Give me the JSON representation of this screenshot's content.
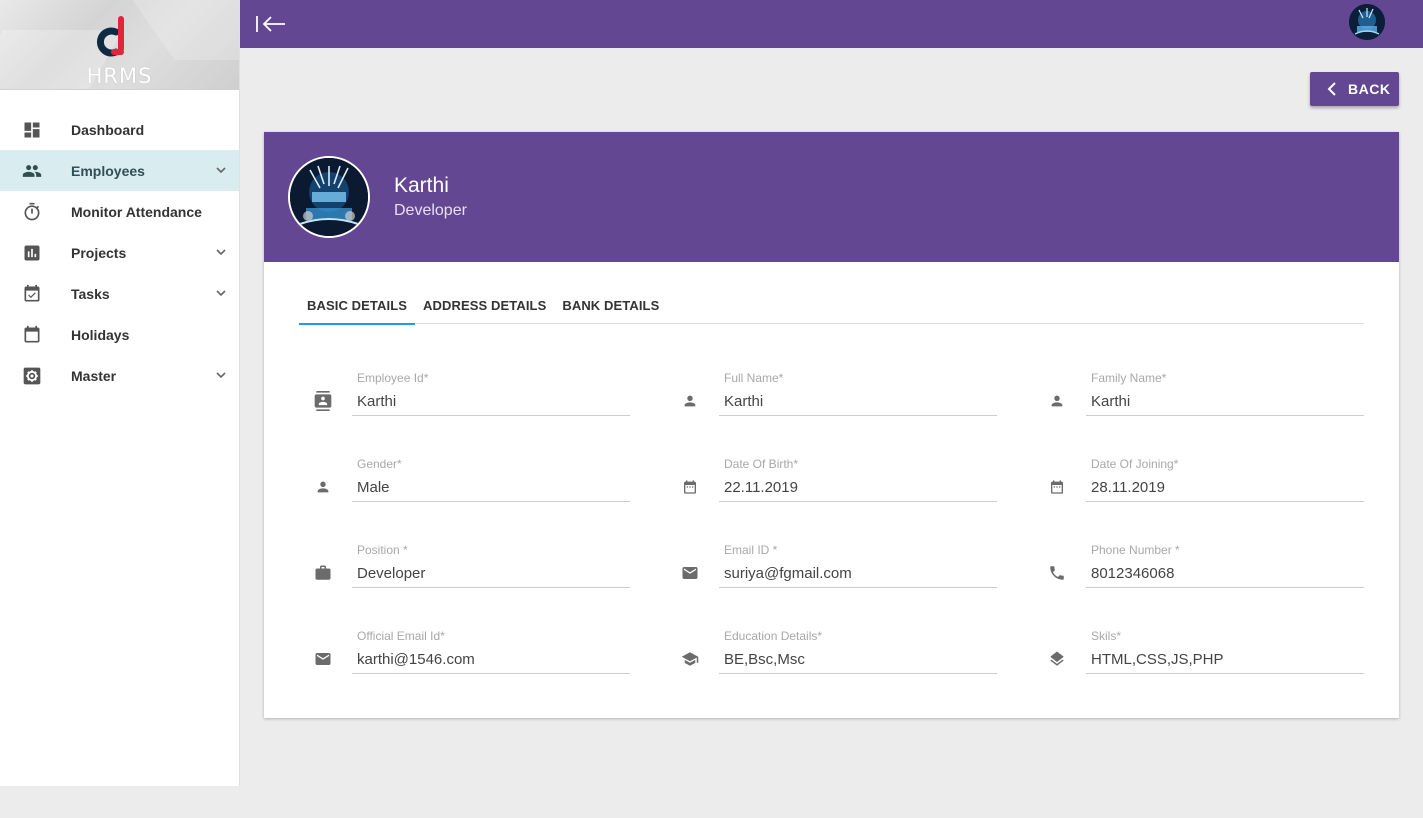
{
  "app": {
    "logo_text": "HRMS"
  },
  "sidebar": {
    "items": [
      {
        "label": "Dashboard",
        "icon": "dashboard-icon",
        "has_submenu": false
      },
      {
        "label": "Employees",
        "icon": "people-icon",
        "has_submenu": true,
        "active": true
      },
      {
        "label": "Monitor Attendance",
        "icon": "timer-icon",
        "has_submenu": false
      },
      {
        "label": "Projects",
        "icon": "bar-chart-icon",
        "has_submenu": true
      },
      {
        "label": "Tasks",
        "icon": "calendar-check-icon",
        "has_submenu": true
      },
      {
        "label": "Holidays",
        "icon": "calendar-icon",
        "has_submenu": false
      },
      {
        "label": "Master",
        "icon": "settings-box-icon",
        "has_submenu": true
      }
    ]
  },
  "toolbar": {
    "back_label": "BACK"
  },
  "profile": {
    "name": "Karthi",
    "role": "Developer"
  },
  "tabs": [
    {
      "label": "BASIC DETAILS",
      "active": true
    },
    {
      "label": "ADDRESS DETAILS",
      "active": false
    },
    {
      "label": "BANK DETAILS",
      "active": false
    }
  ],
  "fields": {
    "employee_id": {
      "label": "Employee Id*",
      "value": "Karthi",
      "icon": "contact-card-icon"
    },
    "full_name": {
      "label": "Full Name*",
      "value": "Karthi",
      "icon": "person-icon"
    },
    "family_name": {
      "label": "Family Name*",
      "value": "Karthi",
      "icon": "person-icon"
    },
    "gender": {
      "label": "Gender*",
      "value": "Male",
      "icon": "person-icon"
    },
    "dob": {
      "label": "Date Of Birth*",
      "value": "22.11.2019",
      "icon": "calendar-icon"
    },
    "doj": {
      "label": "Date Of Joining*",
      "value": "28.11.2019",
      "icon": "calendar-icon"
    },
    "position": {
      "label": "Position *",
      "value": "Developer",
      "icon": "briefcase-icon"
    },
    "email": {
      "label": "Email ID *",
      "value": "suriya@fgmail.com",
      "icon": "mail-icon"
    },
    "phone": {
      "label": "Phone Number *",
      "value": "8012346068",
      "icon": "phone-icon"
    },
    "official_email": {
      "label": "Official Email Id*",
      "value": "karthi@1546.com",
      "icon": "mail-icon"
    },
    "education": {
      "label": "Education Details*",
      "value": "BE,Bsc,Msc",
      "icon": "graduation-cap-icon"
    },
    "skills": {
      "label": "Skils*",
      "value": "HTML,CSS,JS,PHP",
      "icon": "layers-icon"
    }
  },
  "colors": {
    "primary": "#644793",
    "tab_indicator": "#2196f3",
    "active_nav_bg": "#d9ecef"
  }
}
